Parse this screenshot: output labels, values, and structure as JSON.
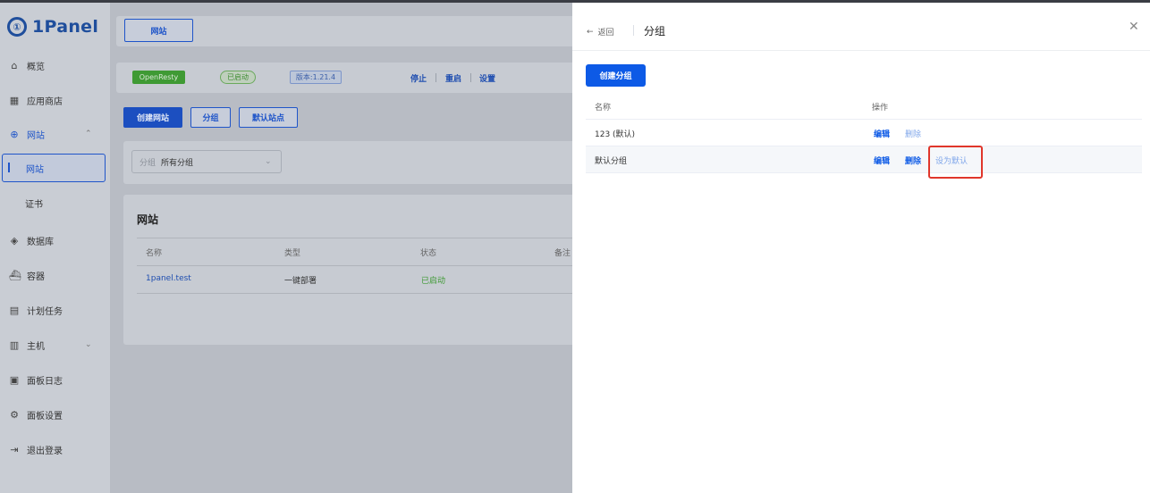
{
  "app": {
    "logo_text": "1Panel",
    "logo_mark": "①"
  },
  "sidebar": {
    "items": [
      {
        "label": "概览",
        "icon": "home-icon"
      },
      {
        "label": "应用商店",
        "icon": "grid-icon"
      },
      {
        "label": "网站",
        "icon": "globe-icon"
      },
      {
        "label": "网站",
        "active": true
      },
      {
        "label": "证书"
      },
      {
        "label": "数据库",
        "icon": "database-icon"
      },
      {
        "label": "容器",
        "icon": "docker-icon"
      },
      {
        "label": "计划任务",
        "icon": "calendar-icon"
      },
      {
        "label": "主机",
        "icon": "host-icon"
      },
      {
        "label": "面板日志",
        "icon": "log-icon"
      },
      {
        "label": "面板设置",
        "icon": "gear-icon"
      },
      {
        "label": "退出登录",
        "icon": "logout-icon"
      }
    ]
  },
  "main": {
    "top_tab": "网站",
    "openresty": {
      "name": "OpenResty",
      "status": "已启动",
      "version": "版本:1.21.4",
      "actions": [
        "停止",
        "重启",
        "设置"
      ]
    },
    "toolbar": {
      "create": "创建网站",
      "group": "分组",
      "default_site": "默认站点"
    },
    "filter": {
      "label": "分组",
      "value": "所有分组"
    },
    "table": {
      "title": "网站",
      "headers": [
        "名称",
        "类型",
        "状态",
        "备注"
      ],
      "rows": [
        {
          "name": "1panel.test",
          "type": "一键部署",
          "status": "已启动"
        }
      ]
    }
  },
  "drawer": {
    "back": "返回",
    "title": "分组",
    "create_button": "创建分组",
    "headers": {
      "name": "名称",
      "action": "操作"
    },
    "rows": [
      {
        "name": "123 (默认)",
        "edit": "编辑",
        "delete": "删除"
      },
      {
        "name": "默认分组",
        "edit": "编辑",
        "delete": "删除",
        "set_default": "设为默认"
      }
    ]
  },
  "colors": {
    "primary": "#0d5ae6",
    "highlight_box": "#e0362b",
    "success": "#3f9a34"
  }
}
